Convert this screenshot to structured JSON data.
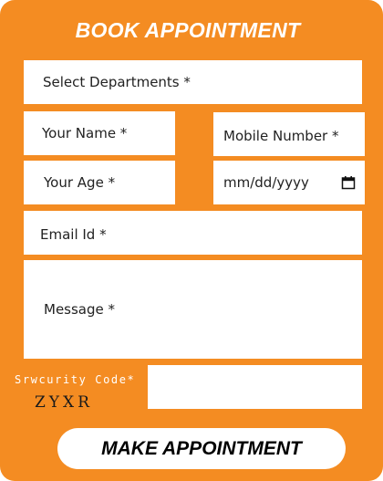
{
  "form": {
    "title": "BOOK APPOINTMENT",
    "department_placeholder": "Select Departments *",
    "name_placeholder": "Your Name *",
    "mobile_placeholder": "Mobile Number *",
    "age_placeholder": "Your Age *",
    "date_placeholder": "mm/dd/yyyy",
    "email_placeholder": "Email Id *",
    "message_placeholder": "Message *",
    "security_label": "Srwcurity Code*",
    "captcha_code": "ZYXR",
    "security_value": "",
    "submit_label": "MAKE APPOINTMENT"
  },
  "icons": {
    "date": "calendar-icon"
  },
  "colors": {
    "background": "#f48c22",
    "field": "#ffffff",
    "title": "#ffffff"
  }
}
